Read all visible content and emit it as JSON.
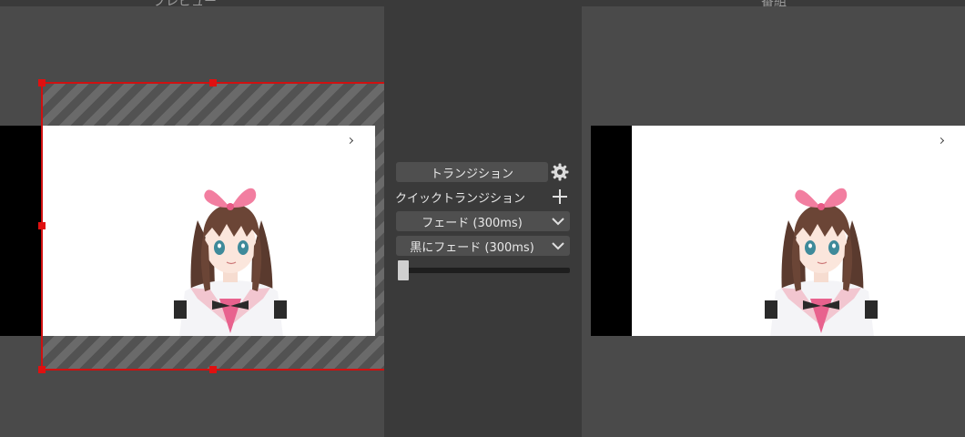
{
  "panes": {
    "preview_title": "プレビュー",
    "program_title": "番組"
  },
  "transition": {
    "button_label": "トランジション",
    "quick_label": "クイックトランジション",
    "options": [
      {
        "label": "フェード (300ms)"
      },
      {
        "label": "黒にフェード (300ms)"
      }
    ],
    "tbar_value": 0
  },
  "icons": {
    "settings": "gear-icon",
    "add": "plus-icon",
    "dropdown": "chevron-down-icon"
  },
  "colors": {
    "selection": "#d01010",
    "pane_bg": "#4a4a4a",
    "panel_bg": "#3a3a3a"
  }
}
